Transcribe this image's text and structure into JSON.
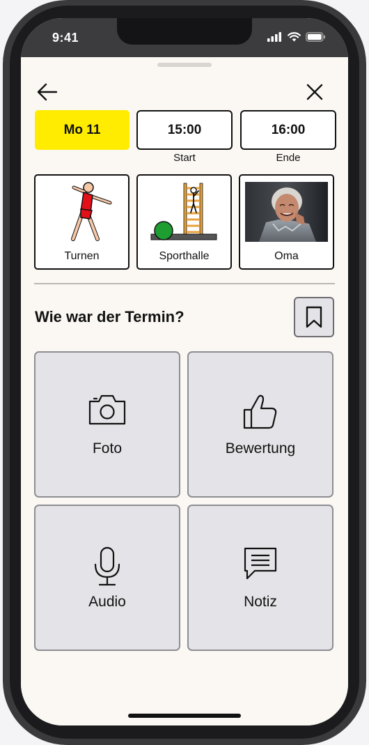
{
  "status_bar": {
    "time": "9:41"
  },
  "header": {
    "back_icon": "arrow-left-icon",
    "close_icon": "close-icon"
  },
  "appointment": {
    "day": "Mo 11",
    "start_time": "15:00",
    "start_caption": "Start",
    "end_time": "16:00",
    "end_caption": "Ende"
  },
  "cards": [
    {
      "label": "Turnen",
      "icon": "gymnastics-pictogram"
    },
    {
      "label": "Sporthalle",
      "icon": "gym-hall-pictogram"
    },
    {
      "label": "Oma",
      "icon": "grandma-photo"
    }
  ],
  "feedback": {
    "title": "Wie war der Termin?",
    "bookmark_icon": "bookmark-icon",
    "options": [
      {
        "label": "Foto",
        "icon": "camera-icon"
      },
      {
        "label": "Bewertung",
        "icon": "thumbs-up-icon"
      },
      {
        "label": "Audio",
        "icon": "microphone-icon"
      },
      {
        "label": "Notiz",
        "icon": "note-icon"
      }
    ]
  },
  "colors": {
    "accent_yellow": "#ffec00",
    "tile_bg": "#e4e4e8",
    "sheet_bg": "#fbf8f4"
  }
}
